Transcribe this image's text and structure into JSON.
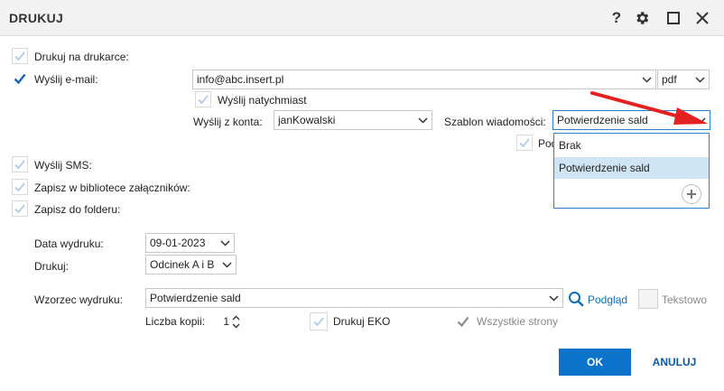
{
  "window": {
    "title": "DRUKUJ"
  },
  "options": {
    "print_printer": "Drukuj na drukarce:",
    "send_email": "Wyślij e-mail:",
    "send_now": "Wyślij natychmiast",
    "send_sms": "Wyślij SMS:",
    "save_library": "Zapisz w bibliotece załączników:",
    "save_folder": "Zapisz do folderu:"
  },
  "email": {
    "address": "info@abc.insert.pl",
    "format": "pdf",
    "account_label": "Wyślij z konta:",
    "account_value": "janKowalski",
    "template_label": "Szablon wiadomości:",
    "template_value": "Potwierdzenie sald",
    "partial_checkbox_label": "Pod"
  },
  "template_dropdown": {
    "items": [
      "Brak",
      "Potwierdzenie sald"
    ],
    "selected_index": 1
  },
  "print": {
    "date_label": "Data wydruku:",
    "date_value": "09-01-2023",
    "print_label": "Drukuj:",
    "print_value": "Odcinek A i B",
    "pattern_label": "Wzorzec wydruku:",
    "pattern_value": "Potwierdzenie sald",
    "preview": "Podgląd",
    "text_mode": "Tekstowo",
    "copies_label": "Liczba kopii:",
    "copies_value": "1",
    "eko": "Drukuj EKO",
    "all_pages": "Wszystkie strony"
  },
  "buttons": {
    "ok": "OK",
    "cancel": "ANULUJ"
  },
  "colors": {
    "accent": "#0b73c9",
    "check": "#1565c0",
    "check_light": "#a7c7e7",
    "arrow": "#e52020"
  }
}
